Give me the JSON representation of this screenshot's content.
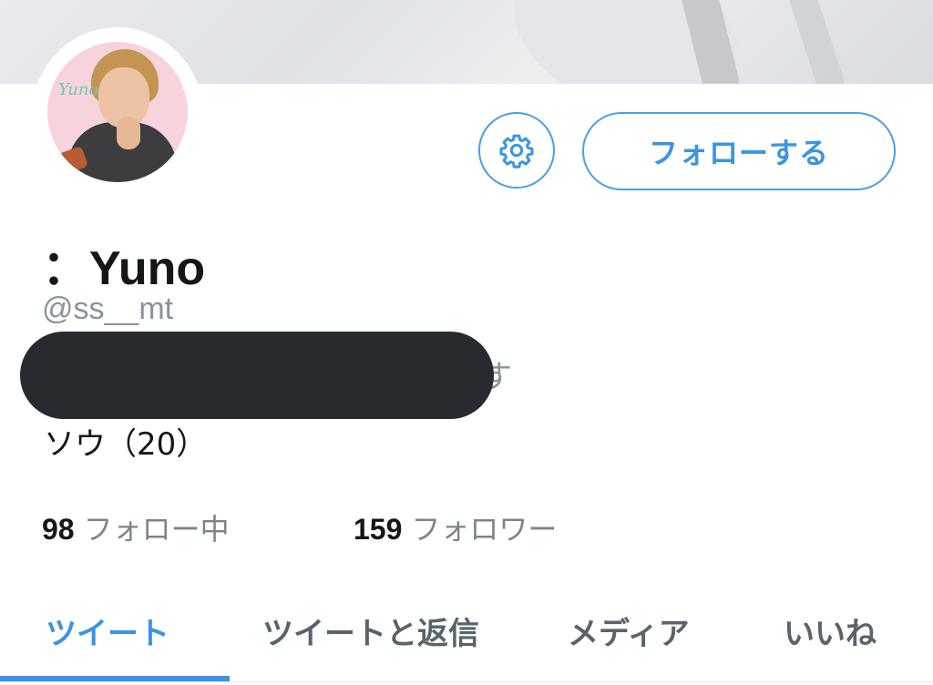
{
  "profile": {
    "display_name": "：Yuno",
    "handle": "@ss__mt",
    "bio_partial": "す",
    "bio_line2": "ソウ（20）",
    "avatar_logo_text": "Yuno"
  },
  "actions": {
    "settings_icon": "gear-icon",
    "follow_label": "フォローする",
    "accent_color": "#3b94e3"
  },
  "stats": {
    "following_count": "98",
    "following_label": "フォロー中",
    "followers_count": "159",
    "followers_label": "フォロワー"
  },
  "tabs": [
    {
      "label": "ツイート",
      "active": true
    },
    {
      "label": "ツイートと返信",
      "active": false
    },
    {
      "label": "メディア",
      "active": false
    },
    {
      "label": "いいね",
      "active": false
    }
  ]
}
